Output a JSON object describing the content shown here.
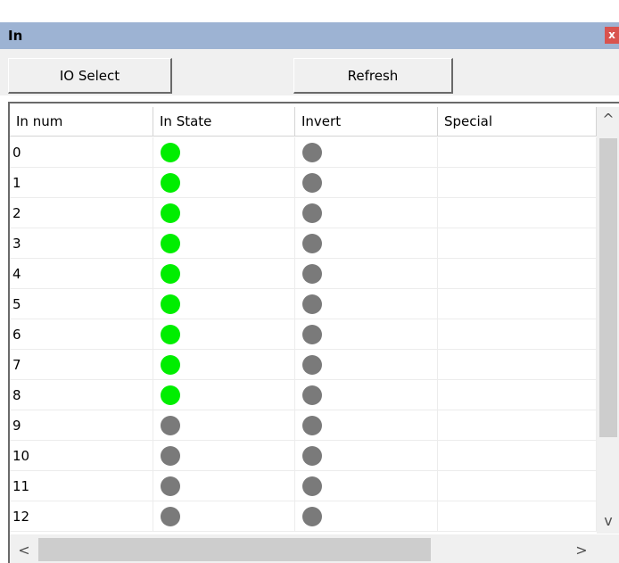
{
  "window": {
    "title": "In",
    "close_glyph": "x"
  },
  "toolbar": {
    "io_select_label": "IO Select",
    "refresh_label": "Refresh"
  },
  "table": {
    "columns": [
      "In num",
      "In State",
      "Invert",
      "Special"
    ],
    "rows": [
      {
        "num": "0",
        "state": "on",
        "invert": "off",
        "special": ""
      },
      {
        "num": "1",
        "state": "on",
        "invert": "off",
        "special": ""
      },
      {
        "num": "2",
        "state": "on",
        "invert": "off",
        "special": ""
      },
      {
        "num": "3",
        "state": "on",
        "invert": "off",
        "special": ""
      },
      {
        "num": "4",
        "state": "on",
        "invert": "off",
        "special": ""
      },
      {
        "num": "5",
        "state": "on",
        "invert": "off",
        "special": ""
      },
      {
        "num": "6",
        "state": "on",
        "invert": "off",
        "special": ""
      },
      {
        "num": "7",
        "state": "on",
        "invert": "off",
        "special": ""
      },
      {
        "num": "8",
        "state": "on",
        "invert": "off",
        "special": ""
      },
      {
        "num": "9",
        "state": "off",
        "invert": "off",
        "special": ""
      },
      {
        "num": "10",
        "state": "off",
        "invert": "off",
        "special": ""
      },
      {
        "num": "11",
        "state": "off",
        "invert": "off",
        "special": ""
      },
      {
        "num": "12",
        "state": "off",
        "invert": "off",
        "special": ""
      }
    ]
  },
  "colors": {
    "on": "#00ee00",
    "off": "#7a7a7a",
    "title_bar": "#9db3d3",
    "close": "#d9534f"
  },
  "scrollbars": {
    "up_glyph": "^",
    "down_glyph": "v",
    "left_glyph": "<",
    "right_glyph": ">"
  }
}
